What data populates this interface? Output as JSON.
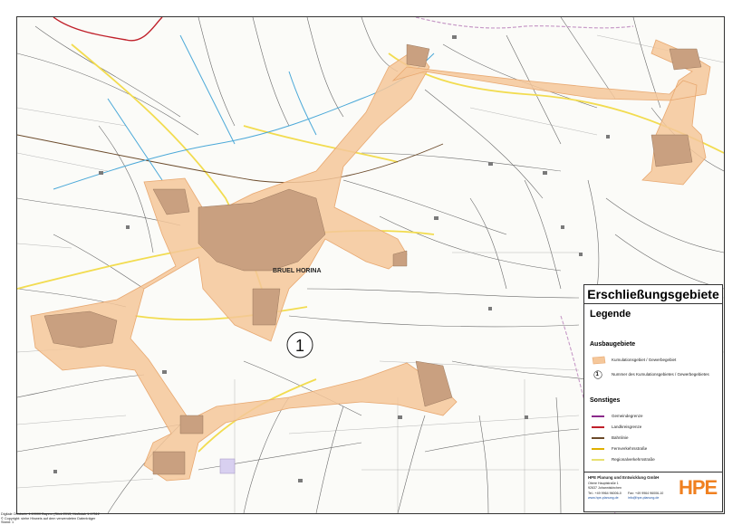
{
  "map": {
    "town_label": "BRUEL HORINA",
    "zone_number": "1"
  },
  "legend": {
    "title": "Erschließungsgebiete",
    "heading": "Legende",
    "section_ausbau": "Ausbaugebiete",
    "items_ausbau": [
      {
        "label": "Kumulationsgebiet / Gewerbegebiet"
      },
      {
        "label": "Nummer des Kumulationsgebietes / Gewerbegebietes",
        "symbol": "1"
      }
    ],
    "section_sonstiges": "Sonstiges",
    "items_sonstiges": [
      {
        "label": "Gemeindegrenze",
        "color": "#8b2a8b"
      },
      {
        "label": "Landkreisgrenze",
        "color": "#c0202a"
      },
      {
        "label": "Bahnlinie",
        "color": "#6b4a2a"
      },
      {
        "label": "Fernverkehrsstraße",
        "color": "#e0b000"
      },
      {
        "label": "Regionalverkehrsstraße",
        "color": "#e8e070"
      }
    ]
  },
  "footer": {
    "company": "HPE Planung und Entwicklung GmbH",
    "address1": "Obere Hauptstraße 1",
    "address2": "92637 Johanniskirchen",
    "tel": "Tel.: +49 9964 96006-0",
    "fax": "Fax: +49 9964 96006-10",
    "web": "www.hpe-planung.de",
    "mail": "info@hpe-planung.de",
    "logo": "HPE"
  },
  "credits": {
    "line1": "Digitale Ortskarte 1:10000 Bayern (Stick 2013, Maßstab 1:17512",
    "line2": "© Copyright: siehe Hinweis auf dem verwendeten Datenträger",
    "line3": "Stand: 1"
  },
  "colors": {
    "zone_fill": "#f5c79a",
    "zone_stroke": "#e8a870",
    "settlement": "#c9a080",
    "river": "#4aa8d8",
    "road_main": "#f2dc50",
    "road": "#555555"
  }
}
